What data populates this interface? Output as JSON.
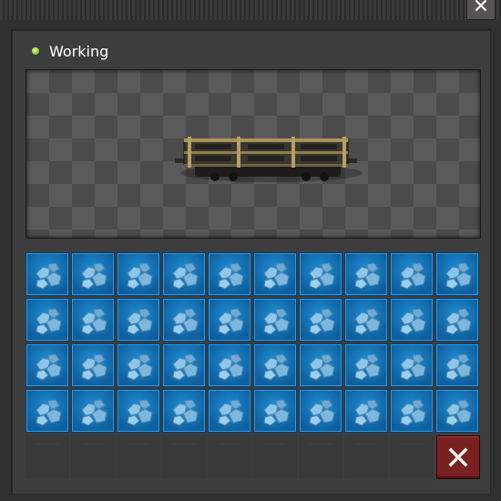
{
  "window": {
    "close_icon": "close-icon",
    "close_glyph": "✕"
  },
  "status": {
    "text": "Working",
    "indicator_color": "#7cd41e"
  },
  "preview": {
    "entity": "cargo-wagon",
    "icon": "cargo-wagon-icon"
  },
  "inventory": {
    "columns": 10,
    "filled_slots": 40,
    "empty_slots": 9,
    "item_icon": "iron-ore-icon",
    "slot_color": "#1e8fd6"
  },
  "actions": {
    "delete_icon": "close-icon",
    "delete_color": "#7a2020"
  }
}
